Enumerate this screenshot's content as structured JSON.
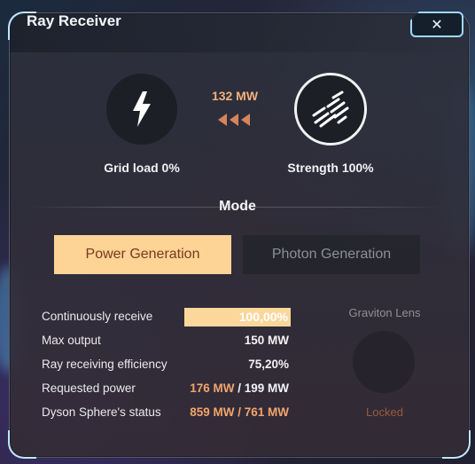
{
  "window": {
    "title": "Ray Receiver",
    "close_label": "✕"
  },
  "status": {
    "grid_load_label": "Grid load 0%",
    "strength_label": "Strength 100%",
    "power_flow": "132 MW",
    "grid_icon": "lightning-bolt-icon",
    "strength_icon": "ray-strength-icon",
    "flow_icon": "triple-left-arrow-icon"
  },
  "mode": {
    "label": "Mode",
    "tabs": [
      {
        "label": "Power Generation",
        "active": true
      },
      {
        "label": "Photon Generation",
        "active": false
      }
    ]
  },
  "stats": {
    "continuous_receive": {
      "label": "Continuously receive",
      "value": "100,00%"
    },
    "max_output": {
      "label": "Max output",
      "value": "150 MW"
    },
    "efficiency": {
      "label": "Ray receiving efficiency",
      "value": "75,20%"
    },
    "requested_power": {
      "label": "Requested power",
      "value_current": "176 MW",
      "value_sep": " / ",
      "value_max": "199 MW"
    },
    "dyson_status": {
      "label": "Dyson Sphere's status",
      "value": "859 MW / 761 MW"
    }
  },
  "lens": {
    "title": "Graviton Lens",
    "state": "Locked"
  },
  "colors": {
    "accent": "#fdd396",
    "accent_text": "#7a3a1a",
    "value_orange": "#f3a56c",
    "frame": "#9fd8ff"
  }
}
